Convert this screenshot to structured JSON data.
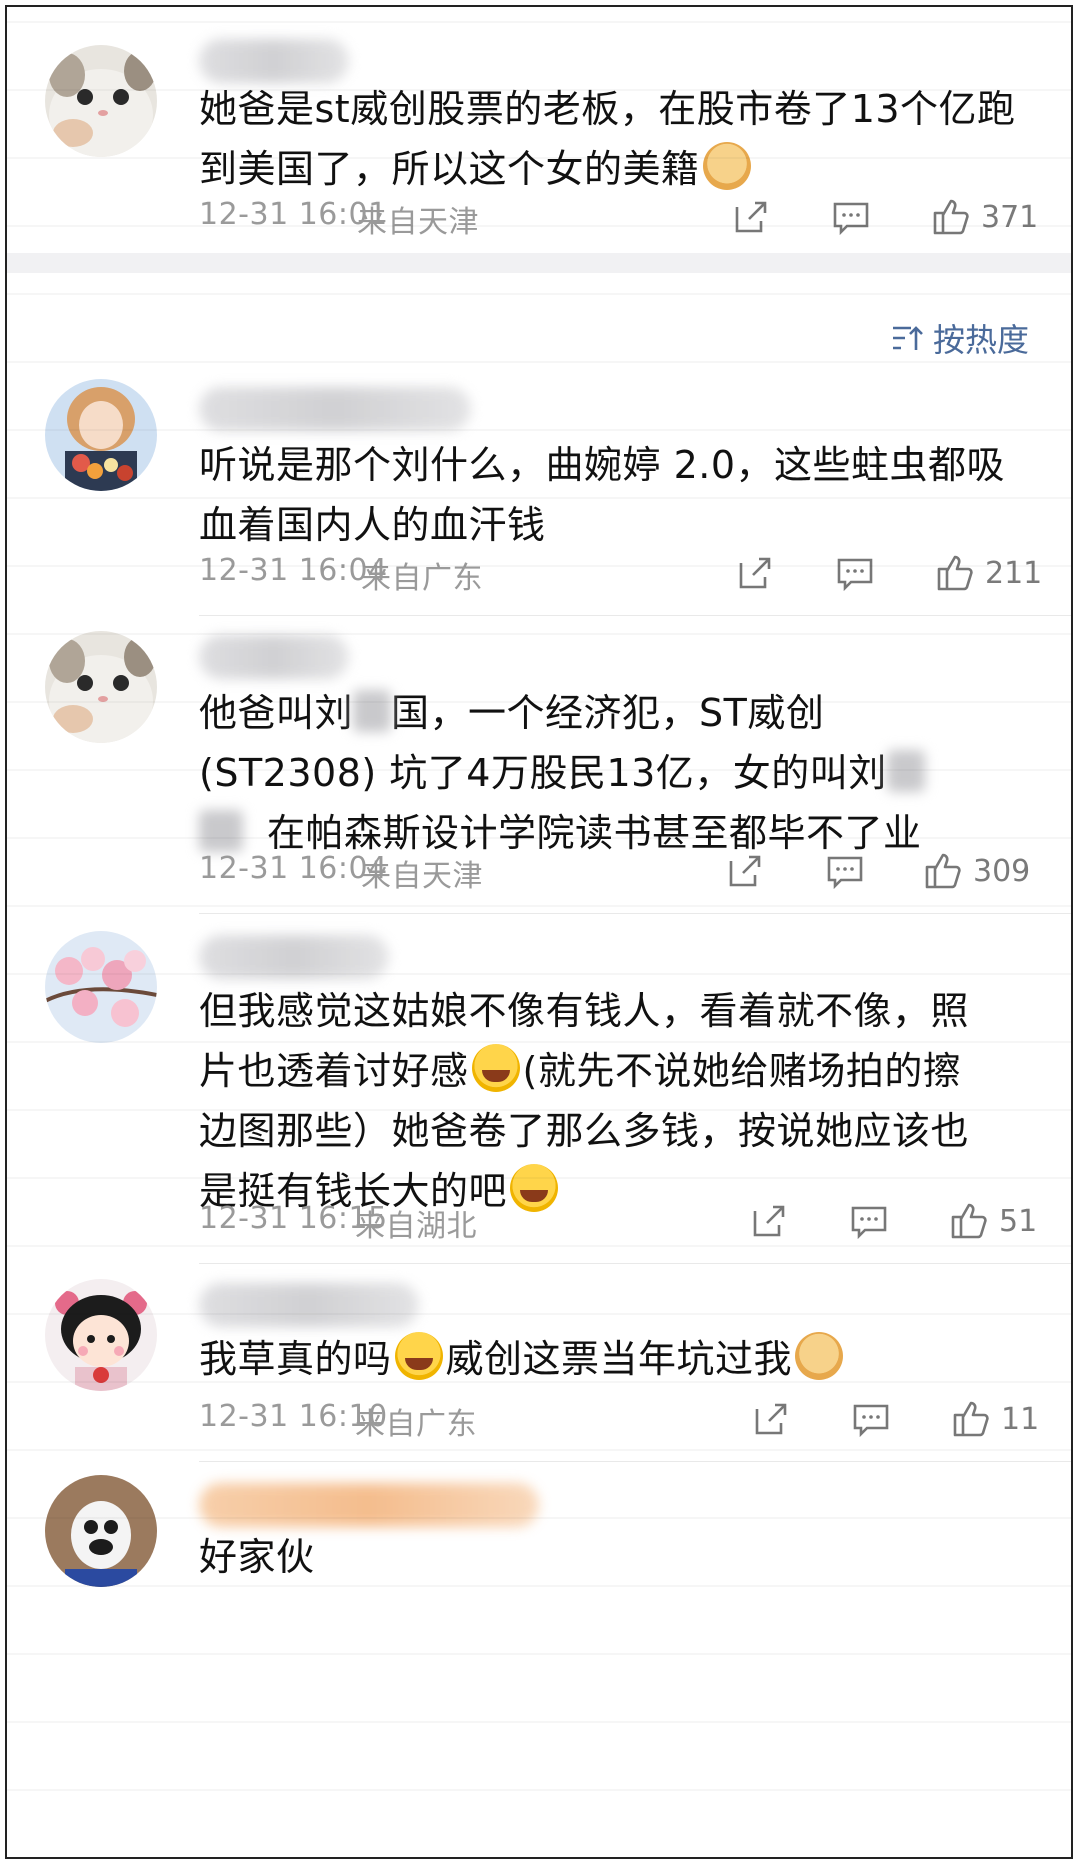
{
  "sort": {
    "label": "按热度"
  },
  "comments": [
    {
      "text_parts": [
        "她爸是st威创股票的老板，在股市卷了13个亿跑到美国了，所以这个女的美籍"
      ],
      "time": "12-31 16:01",
      "location": "来自天津",
      "likes": "371"
    },
    {
      "text_parts": [
        "听说是那个刘什么，曲婉婷 2.0，这些蛀虫都吸血着国内人的血汗钱"
      ],
      "time": "12-31 16:04",
      "location": "来自广东",
      "likes": "211"
    },
    {
      "line1_a": "他爸叫刘",
      "line1_b": "国，一个经济犯，ST威创",
      "line2": "(ST2308) 坑了4万股民13亿，女的叫刘",
      "line3": "在帕森斯设计学院读书甚至都毕不了业",
      "time": "12-31 16:04",
      "location": "来自天津",
      "likes": "309"
    },
    {
      "line1": "但我感觉这姑娘不像有钱人，看着就不像，照",
      "line2_a": "片也透着讨好感",
      "line2_b": "(就先不说她给赌场拍的擦",
      "line3": "边图那些）她爸卷了那么多钱，按说她应该也",
      "line4": "是挺有钱长大的吧",
      "time": "12-31 16:15",
      "location": "来自湖北",
      "likes": "51"
    },
    {
      "part_a": "我草真的吗",
      "part_b": "威创这票当年坑过我",
      "time": "12-31 16:10",
      "location": "来自广东",
      "likes": "11"
    },
    {
      "text": "好家伙"
    }
  ],
  "icons": {
    "share": "share-icon",
    "comment": "comment-icon",
    "like": "thumbs-up-icon",
    "sort": "sort-icon"
  },
  "colors": {
    "text": "#111111",
    "meta": "#9a9a9a",
    "sort": "#4a6a9a"
  }
}
